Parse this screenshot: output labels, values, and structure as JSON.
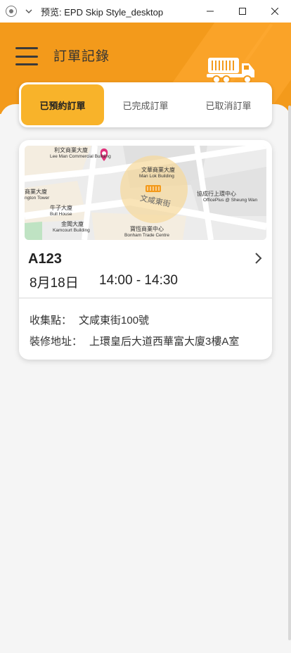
{
  "window": {
    "title": "预览: EPD Skip Style_desktop",
    "controls": [
      "minimize-icon",
      "maximize-icon",
      "close-icon"
    ]
  },
  "header": {
    "title": "訂單記錄",
    "menu_icon": "hamburger-menu-icon",
    "illustration": "truck-icon",
    "background_color": "#f39a1b"
  },
  "tabs": [
    {
      "label": "已預約訂單",
      "active": true
    },
    {
      "label": "已完成訂單",
      "active": false
    },
    {
      "label": "已取消訂單",
      "active": false
    }
  ],
  "booking": {
    "id": "A123",
    "date": "8月18日",
    "time": "14:00 - 14:30",
    "collection_label": "收集點：",
    "collection_value": "文咸東街100號",
    "address_label": "裝修地址：",
    "address_value": "上環皇后大道西華富大廈3樓A室",
    "map": {
      "street_label": "文咸東街",
      "places": [
        {
          "zh": "利文商業大廈",
          "en": "Lee Man Commercial Building"
        },
        {
          "zh": "文華商業大廈",
          "en": "Man Lok Building"
        },
        {
          "zh": "商業大廈",
          "en": "ngton Tower"
        },
        {
          "zh": "協成行上環中心",
          "en": "OfficePlus @ Sheung Wan"
        },
        {
          "zh": "牛子大廈",
          "en": "Bull House"
        },
        {
          "zh": "金聞大廈",
          "en": "Kamcourt Building"
        },
        {
          "zh": "寶恆商業中心",
          "en": "Bonham Trade Centre"
        }
      ]
    }
  },
  "accent_color": "#f8b32a"
}
